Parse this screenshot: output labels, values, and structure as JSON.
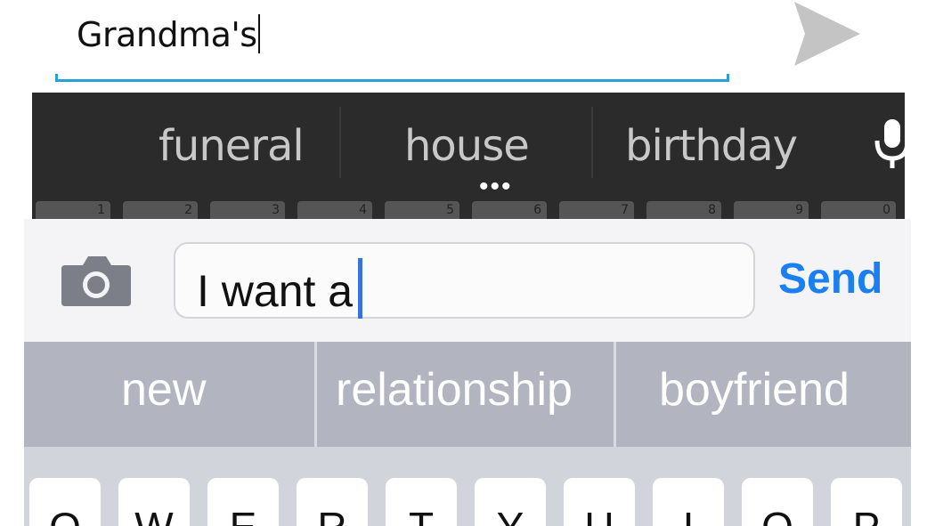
{
  "android": {
    "compose": {
      "input_value": "Grandma's",
      "send_icon": "send-arrow-icon"
    },
    "suggestions": [
      "funeral",
      "house",
      "birthday"
    ],
    "more_indicator": "•••",
    "mic_icon": "microphone-icon",
    "number_keys": [
      "1",
      "2",
      "3",
      "4",
      "5",
      "6",
      "7",
      "8",
      "9",
      "0"
    ],
    "colors": {
      "underline": "#2a9fd6",
      "strip_bg": "#2b2b2b",
      "suggestion_text": "#c8c8c8"
    }
  },
  "ios": {
    "camera_icon": "camera-icon",
    "input_value": "I want a",
    "send_label": "Send",
    "suggestions": [
      "new",
      "relationship",
      "boyfriend"
    ],
    "keys": [
      "Q",
      "W",
      "E",
      "R",
      "T",
      "Y",
      "U",
      "I",
      "O",
      "P"
    ],
    "colors": {
      "send": "#1a7ff0",
      "caret": "#3c6fe0",
      "strip_bg": "#b2b5c0"
    }
  }
}
